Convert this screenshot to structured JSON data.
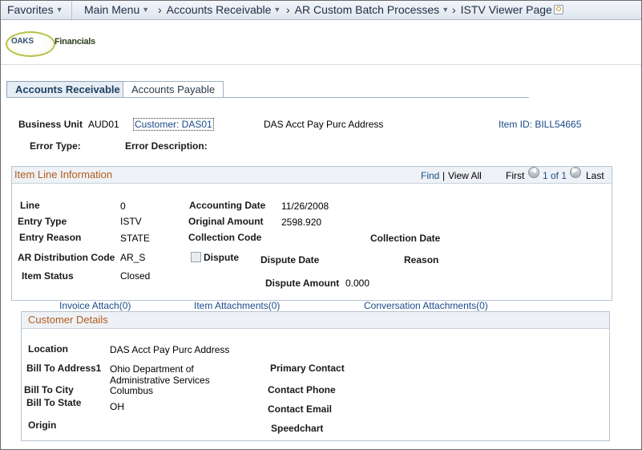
{
  "nav": {
    "favorites": "Favorites",
    "main_menu": "Main Menu",
    "accounts_receivable": "Accounts Receivable",
    "ar_custom_batch": "AR Custom Batch Processes",
    "istv_viewer": "ISTV Viewer Page"
  },
  "header": {
    "logo_text": "OAKS",
    "logo_sub": "Financials"
  },
  "tabs": [
    {
      "label": "Accounts Receivable"
    },
    {
      "label": "Accounts Payable"
    }
  ],
  "top": {
    "business_unit_label": "Business Unit",
    "business_unit_value": "AUD01",
    "customer_link": "Customer: DAS01",
    "customer_name": "DAS Acct Pay Purc Address",
    "item_id_link": "Item ID: BILL54665",
    "error_type_label": "Error Type:",
    "error_description_label": "Error Description:"
  },
  "item_line": {
    "title": "Item Line Information",
    "find": "Find",
    "pipe": "|",
    "view_all": "View All",
    "first": "First",
    "position": "1 of 1",
    "last": "Last",
    "line_label": "Line",
    "line_value": "0",
    "accounting_date_label": "Accounting Date",
    "accounting_date_value": "11/26/2008",
    "entry_type_label": "Entry Type",
    "entry_type_value": "ISTV",
    "original_amount_label": "Original Amount",
    "original_amount_value": "2598.920",
    "entry_reason_label": "Entry Reason",
    "entry_reason_value": "STATE",
    "collection_code_label": "Collection Code",
    "collection_date_label": "Collection Date",
    "ar_dist_label": "AR Distribution Code",
    "ar_dist_value": "AR_S",
    "dispute_label": "Dispute",
    "dispute_date_label": "Dispute Date",
    "reason_label": "Reason",
    "item_status_label": "Item Status",
    "item_status_value": "Closed",
    "dispute_amount_label": "Dispute Amount",
    "dispute_amount_value": "0.000"
  },
  "links": {
    "invoice_attach": "Invoice Attach(0)",
    "item_attachments": "Item Attachments(0)",
    "conversation_attachments": "Conversation Attachments(0)"
  },
  "customer": {
    "title": "Customer Details",
    "location_label": "Location",
    "location_value": "DAS Acct Pay Purc Address",
    "bill_to_address1_label": "Bill To Address1",
    "bill_to_address1_line1": "Ohio Department of",
    "bill_to_address1_line2": "Administrative Services",
    "bill_to_city_label": "Bill To City",
    "bill_to_city_value": "Columbus",
    "bill_to_state_label": "Bill To State",
    "bill_to_state_value": "OH",
    "origin_label": "Origin",
    "primary_contact_label": "Primary Contact",
    "contact_phone_label": "Contact Phone",
    "contact_email_label": "Contact Email",
    "speedchart_label": "Speedchart"
  },
  "colors": {
    "section_title": "#b25a1e",
    "link": "#1a4a8a",
    "nav_bg": "#dfe6ee"
  }
}
